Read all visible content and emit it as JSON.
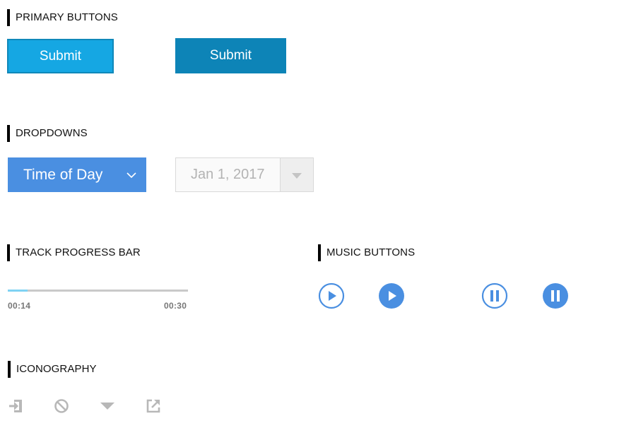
{
  "sections": {
    "primary_buttons": "PRIMARY BUTTONS",
    "dropdowns": "DROPDOWNS",
    "track_progress_bar": "TRACK PROGRESS BAR",
    "music_buttons": "MUSIC BUTTONS",
    "iconography": "ICONOGRAPHY"
  },
  "primary_buttons": {
    "submit_default": "Submit",
    "submit_hover": "Submit"
  },
  "dropdowns": {
    "time_of_day": {
      "value": "Time of Day"
    },
    "date": {
      "value": "Jan 1, 2017"
    }
  },
  "progress": {
    "fraction": 0.11,
    "current": "00:14",
    "total": "00:30"
  },
  "music": {
    "buttons": [
      {
        "icon": "play-outline-icon"
      },
      {
        "icon": "play-filled-icon"
      },
      {
        "icon": "pause-outline-icon"
      },
      {
        "icon": "pause-filled-icon"
      }
    ]
  },
  "icons": [
    "logout-icon",
    "block-icon",
    "caret-down-icon",
    "external-link-icon"
  ],
  "colors": {
    "accent_blue": "#4a8fe1",
    "submit_light": "#15a7e3",
    "submit_dark": "#0d84b7",
    "progress_fill": "#7fd2f3",
    "icon_gray": "#b8b8b8"
  }
}
